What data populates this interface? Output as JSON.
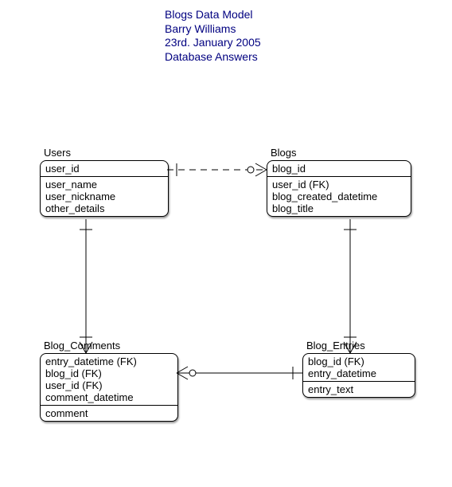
{
  "header": {
    "title": "Blogs Data Model",
    "author": "Barry Williams",
    "date": "23rd. January 2005",
    "org": "Database Answers"
  },
  "entities": {
    "users": {
      "name": "Users",
      "pk": [
        "user_id"
      ],
      "attrs": [
        "user_name",
        "user_nickname",
        "other_details"
      ]
    },
    "blogs": {
      "name": "Blogs",
      "pk": [
        "blog_id"
      ],
      "attrs": [
        "user_id (FK)",
        "blog_created_datetime",
        "blog_title"
      ]
    },
    "blog_comments": {
      "name": "Blog_Comments",
      "pk": [
        "entry_datetime (FK)",
        "blog_id (FK)",
        "user_id (FK)",
        "comment_datetime"
      ],
      "attrs": [
        "comment"
      ]
    },
    "blog_entries": {
      "name": "Blog_Entries",
      "pk": [
        "blog_id (FK)",
        "entry_datetime"
      ],
      "attrs": [
        "entry_text"
      ]
    }
  },
  "relationships": [
    {
      "from": "users",
      "to": "blogs",
      "type": "one-to-many",
      "style": "dashed"
    },
    {
      "from": "users",
      "to": "blog_comments",
      "type": "one-to-many",
      "style": "solid"
    },
    {
      "from": "blogs",
      "to": "blog_entries",
      "type": "one-to-many",
      "style": "solid"
    },
    {
      "from": "blog_entries",
      "to": "blog_comments",
      "type": "one-to-many",
      "style": "solid"
    }
  ]
}
